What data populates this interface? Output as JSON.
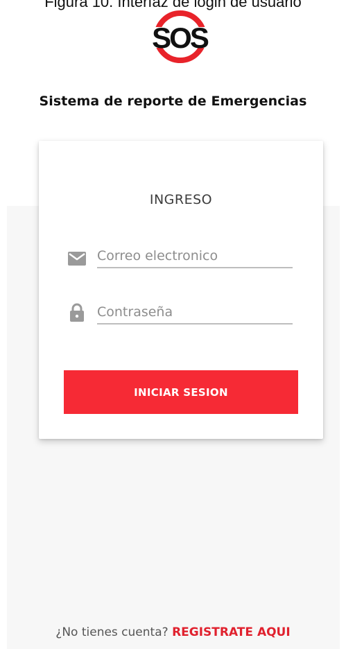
{
  "caption": "Figura 10. Interfaz de login de usuario",
  "logo": {
    "text": "SOS",
    "ring_color": "#e8232a",
    "text_color": "#111111"
  },
  "app_title": "Sistema de reporte de Emergencias",
  "login": {
    "title": "INGRESO",
    "email": {
      "placeholder": "Correo electronico",
      "value": "",
      "icon": "envelope-icon"
    },
    "password": {
      "placeholder": "Contraseña",
      "value": "",
      "icon": "lock-icon"
    },
    "submit_label": "INICIAR SESION"
  },
  "footer": {
    "prompt": "¿No tienes cuenta?",
    "register_link": "REGISTRATE AQUI"
  },
  "colors": {
    "accent": "#f62a35",
    "link": "#e0212e",
    "background_panel": "#f7f7f7"
  }
}
